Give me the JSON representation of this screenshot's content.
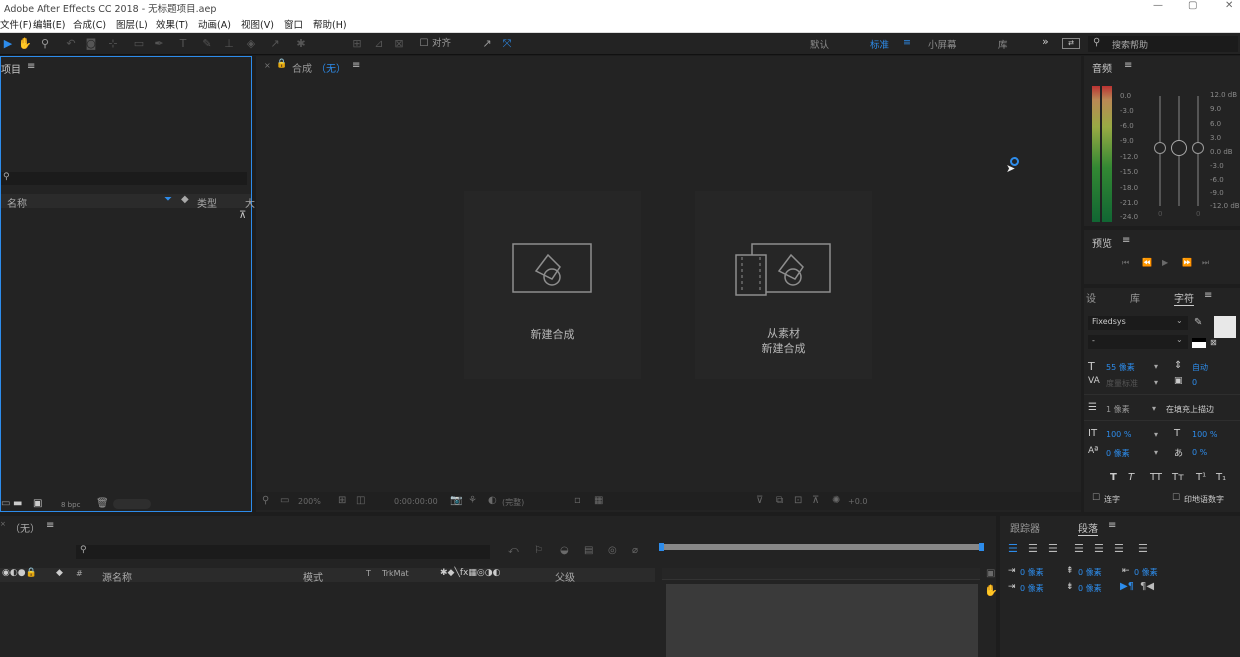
{
  "window": {
    "title": "Adobe After Effects CC 2018 - 无标题项目.aep",
    "min_icon": "—",
    "max_icon": "▢",
    "close_icon": "✕"
  },
  "menu": [
    "文件(F)",
    "编辑(E)",
    "合成(C)",
    "图层(L)",
    "效果(T)",
    "动画(A)",
    "视图(V)",
    "窗口",
    "帮助(H)"
  ],
  "toolbar": {
    "align_label": "对齐",
    "workspaces": [
      "默认",
      "标准",
      "小屏幕",
      "库"
    ],
    "active_workspace": "标准",
    "more": "»",
    "search_placeholder": "搜索帮助"
  },
  "project": {
    "title": "项目",
    "menu_icon": "≡",
    "col_name": "名称",
    "col_type": "类型",
    "col_size": "大",
    "bpc": "8 bpc"
  },
  "composition": {
    "title_prefix": "合成",
    "title_value": "（无）",
    "menu_icon": "≡",
    "new_comp_label": "新建合成",
    "from_footage_line1": "从素材",
    "from_footage_line2": "新建合成",
    "zoom": "200%",
    "timecode": "0:00:00:00",
    "resolution": "(完整)",
    "exposure": "+0.0"
  },
  "audio": {
    "title": "音频",
    "left_scale": [
      "0.0",
      "-3.0",
      "-6.0",
      "-9.0",
      "-12.0",
      "-15.0",
      "-18.0",
      "-21.0",
      "-24.0"
    ],
    "right_scale": [
      "12.0 dB",
      "9.0",
      "6.0",
      "3.0",
      "0.0 dB",
      "-3.0",
      "-6.0",
      "-9.0",
      "-12.0 dB"
    ],
    "slider_left": "0",
    "slider_right": "0"
  },
  "preview": {
    "title": "预览"
  },
  "character": {
    "tab_effects": "设",
    "tab_library": "库",
    "tab_character": "字符",
    "font": "Fixedsys",
    "style": "-",
    "size": "55 像素",
    "leading": "自动",
    "tracking_label": "度量标准",
    "kerning": "0",
    "stroke_width": "1 像素",
    "stroke_mode": "在填充上描边",
    "vscale": "100 %",
    "hscale": "100 %",
    "baseline": "0 像素",
    "tsume": "0 %",
    "style_buttons": [
      "T",
      "T",
      "TT",
      "Tт",
      "T¹",
      "T₁"
    ],
    "ligature": "连字",
    "hindi_digits": "印地语数字"
  },
  "timeline": {
    "comp_name": "（无）",
    "menu_icon": "≡",
    "col_hash": "#",
    "col_source": "源名称",
    "col_mode": "模式",
    "col_t": "T",
    "col_trkmat": "TrkMat",
    "col_parent": "父级"
  },
  "paragraph": {
    "tab_tracker": "跟踪器",
    "tab_paragraph": "段落",
    "menu_icon": "≡",
    "indent_left": "0 像素",
    "indent_right": "0 像素",
    "indent_first": "0 像素",
    "space_before": "0 像素",
    "space_after": "0 像素"
  },
  "colors": {
    "accent": "#2d8ceb",
    "panel": "#232323",
    "bg": "#1d1d1d"
  }
}
